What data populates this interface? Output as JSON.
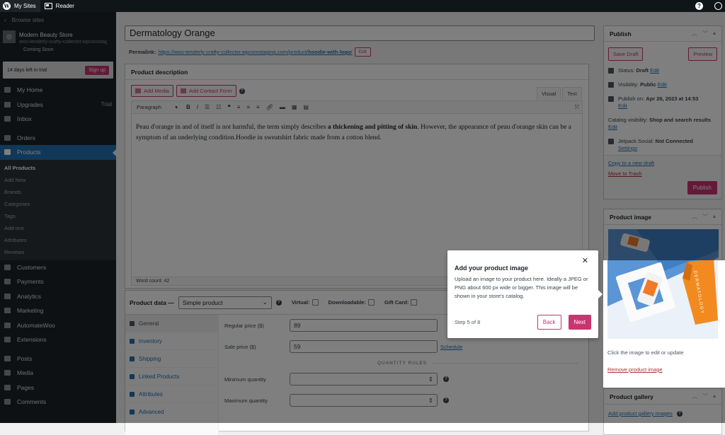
{
  "topbar": {
    "my_sites": "My Sites",
    "reader": "Reader",
    "help": "?"
  },
  "sidebar": {
    "browse": "Browse sites",
    "site_name": "Modern Beauty Store",
    "site_url": "woo-tenderly-crafty-collector.wpcomstaging.com",
    "site_status": "Coming Soon",
    "trial_text": "14 days left in trial",
    "signup": "Sign up",
    "items_top": [
      {
        "label": "My Home"
      },
      {
        "label": "Upgrades",
        "badge": "Trial"
      },
      {
        "label": "Inbox"
      }
    ],
    "orders": "Orders",
    "products": "Products",
    "submenu": [
      "All Products",
      "Add New",
      "Brands",
      "Categories",
      "Tags",
      "Add-ons",
      "Attributes",
      "Reviews"
    ],
    "items_mid": [
      "Customers",
      "Payments",
      "Analytics",
      "Marketing",
      "AutomateWoo",
      "Extensions"
    ],
    "items_bottom": [
      "Posts",
      "Media",
      "Pages",
      "Comments"
    ]
  },
  "editor": {
    "title": "Dermatology Orange",
    "permalink_label": "Permalink:",
    "permalink_base": "https://woo-tenderly-crafty-collector.wpcomstaging.com/product/",
    "permalink_slug": "hoodie-with-logo",
    "permalink_end": "/",
    "edit": "Edit",
    "desc_title": "Product description",
    "add_media": "Add Media",
    "add_contact_form": "Add Contact Form",
    "tab_visual": "Visual",
    "tab_text": "Text",
    "format": "Paragraph",
    "content_1": "Peau d'orange in and of itself is not harmful, the term simply describes ",
    "content_bold": "a thickening and pitting of skin",
    "content_2": ". However, the appearance of peau d'orange skin can be a symptom of an underlying condition.Hoodie in sweatshirt fabric made from a cotton blend.",
    "word_count": "Word count: 42"
  },
  "product_data": {
    "label": "Product data —",
    "type": "Simple product",
    "virtual": "Virtual:",
    "downloadable": "Downloadable:",
    "gift_card": "Gift Card:",
    "tabs": [
      "General",
      "Inventory",
      "Shipping",
      "Linked Products",
      "Attributes",
      "Advanced"
    ],
    "regular_price_label": "Regular price ($)",
    "regular_price": "89",
    "sale_price_label": "Sale price ($)",
    "sale_price": "59",
    "schedule": "Schedule",
    "quantity_rules": "QUANTITY RULES",
    "min_qty_label": "Minimum quantity",
    "max_qty_label": "Maximum quantity"
  },
  "publish": {
    "title": "Publish",
    "save_draft": "Save Draft",
    "preview": "Preview",
    "status_label": "Status:",
    "status": "Draft",
    "visibility_label": "Visibility:",
    "visibility": "Public",
    "publish_on_label": "Publish on:",
    "publish_on": "Apr 26, 2023 at 14:53",
    "catalog_label": "Catalog visibility:",
    "catalog": "Shop and search results",
    "jetpack_label": "Jetpack Social:",
    "jetpack": "Not Connected",
    "settings": "Settings",
    "edit": "Edit",
    "copy_draft": "Copy to a new draft",
    "trash": "Move to Trash",
    "publish_btn": "Publish"
  },
  "product_image": {
    "title": "Product image",
    "caption": "Click the image to edit or update",
    "remove": "Remove product image",
    "box_text": "DERMATOLOGY"
  },
  "product_gallery": {
    "title": "Product gallery",
    "add": "Add product gallery images"
  },
  "tour": {
    "title": "Add your product image",
    "body": "Upload an image to your product here. Ideally a JPEG or PNG about 600 px wide or bigger. This image will be shown in your store's catalog.",
    "step": "Step 5 of 8",
    "back": "Back",
    "next": "Next",
    "close": "✕"
  }
}
